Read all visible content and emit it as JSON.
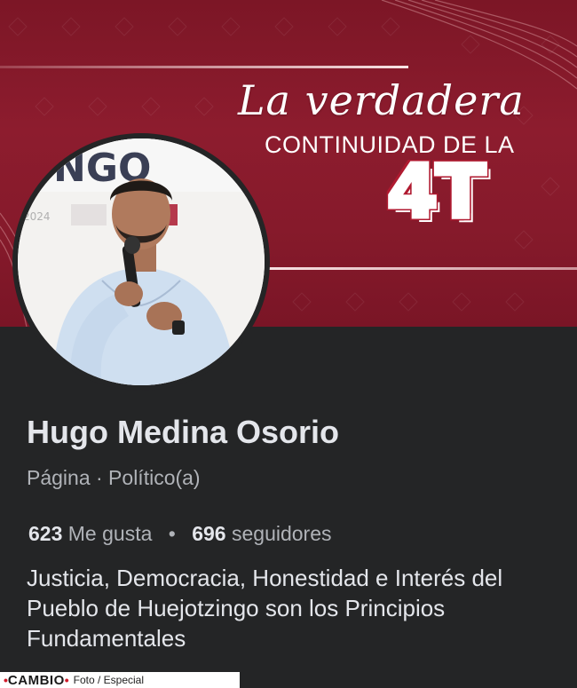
{
  "cover": {
    "script_title": "La verdadera",
    "subtitle": "CONTINUIDAD DE LA",
    "big_text": "4T",
    "colors": {
      "background": "#861a2b",
      "accent": "#b01a30"
    }
  },
  "profile": {
    "avatar_backdrop_text": "NGO",
    "avatar_year_text": "2024",
    "name": "Hugo Medina Osorio",
    "meta": "Página · Político(a)",
    "likes_count": "623",
    "likes_label": "Me gusta",
    "separator": "•",
    "followers_count": "696",
    "followers_label": "seguidores",
    "bio": "Justicia, Democracia, Honestidad e Interés del Pueblo de Huejotzingo son los Principios Fundamentales"
  },
  "credit": {
    "dot_left": "•",
    "brand": "CAMBIO",
    "dot_right": "•",
    "photo_text": "Foto / Especial"
  }
}
